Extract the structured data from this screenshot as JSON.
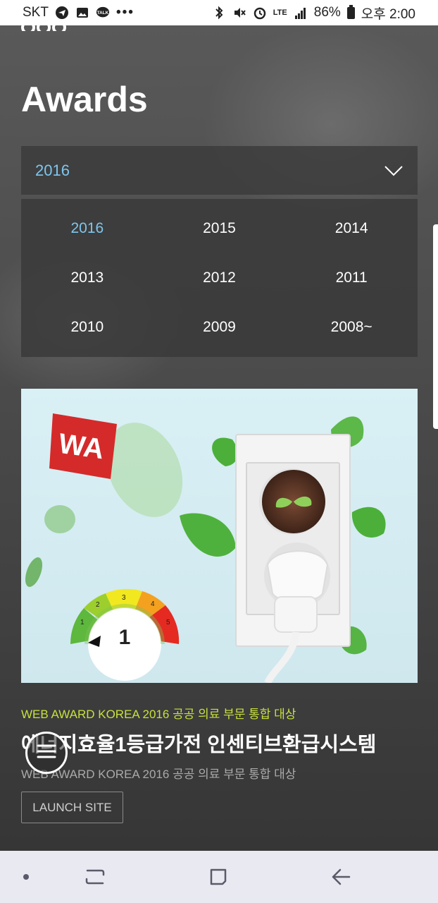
{
  "status_bar": {
    "carrier": "SKT",
    "more": "•••",
    "network": "LTE",
    "battery": "86%",
    "time": "오후 2:00",
    "icons": [
      "telegram-icon",
      "gallery-icon",
      "kakaotalk-icon",
      "bluetooth-icon",
      "mute-icon",
      "alarm-icon",
      "signal-icon",
      "battery-icon"
    ]
  },
  "page": {
    "title": "Awards"
  },
  "year_select": {
    "selected": "2016",
    "options": [
      "2016",
      "2015",
      "2014",
      "2013",
      "2012",
      "2011",
      "2010",
      "2009",
      "2008~"
    ]
  },
  "award": {
    "image": {
      "logo_text": "WA",
      "gauge_labels": [
        "1",
        "2",
        "3",
        "4",
        "5"
      ],
      "gauge_value": "1"
    },
    "subtitle": "WEB AWARD KOREA 2016 공공 의료 부문 통합 대상",
    "title": "에너지효율1등급가전 인센티브환급시스템",
    "description": "WEB AWARD KOREA 2016 공공 의료 부문 통합 대상",
    "launch_label": "LAUNCH SITE"
  },
  "colors": {
    "accent_blue": "#7ec6ee",
    "accent_green": "#c8e03c",
    "award_bg": "#d6eef4",
    "logo_red": "#d52a2a"
  }
}
